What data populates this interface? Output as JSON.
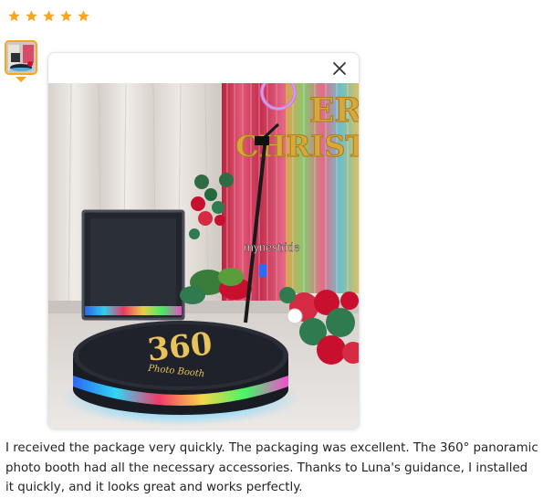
{
  "rating": {
    "stars": 5,
    "max": 5,
    "color": "#f5a623"
  },
  "thumbnail": {
    "selected": true,
    "border_color": "#f5a623"
  },
  "preview": {
    "close_icon": "close-icon",
    "watermark": "mynestride",
    "banner_letters": "ERR CHRIST",
    "platform_text": "360",
    "platform_subtext": "Photo Booth"
  },
  "review": {
    "text": "I received the package very quickly. The packaging was excellent. The 360° panoramic photo booth had all the necessary accessories. Thanks to Luna's guidance, I installed it quickly, and it looks great and works perfectly."
  }
}
